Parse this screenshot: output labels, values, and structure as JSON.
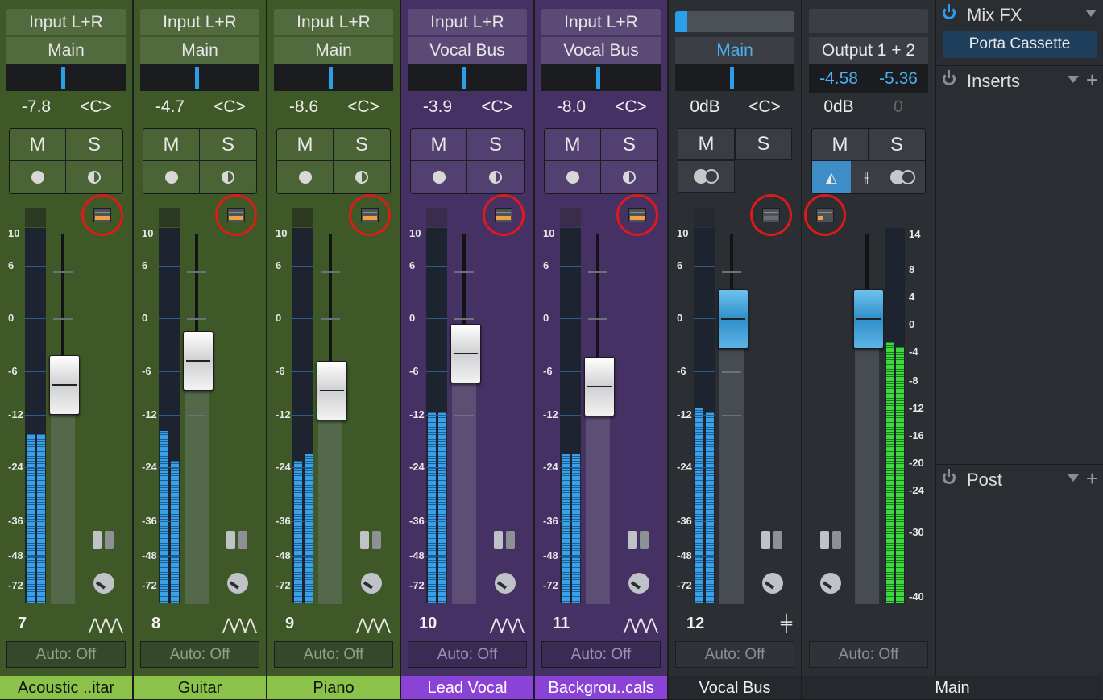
{
  "channels": [
    {
      "input": "Input L+R",
      "output": "Main",
      "vol": "-7.8",
      "pan": "<C>",
      "mute": "M",
      "solo": "S",
      "number": "7",
      "name": "Acoustic ..itar",
      "auto": "Auto: Off",
      "color": "green",
      "fader_db": -7.8
    },
    {
      "input": "Input L+R",
      "output": "Main",
      "vol": "-4.7",
      "pan": "<C>",
      "mute": "M",
      "solo": "S",
      "number": "8",
      "name": "Guitar",
      "auto": "Auto: Off",
      "color": "green",
      "fader_db": -4.7
    },
    {
      "input": "Input L+R",
      "output": "Main",
      "vol": "-8.6",
      "pan": "<C>",
      "mute": "M",
      "solo": "S",
      "number": "9",
      "name": "Piano",
      "auto": "Auto: Off",
      "color": "green",
      "fader_db": -8.6
    },
    {
      "input": "Input L+R",
      "output": "Vocal Bus",
      "vol": "-3.9",
      "pan": "<C>",
      "mute": "M",
      "solo": "S",
      "number": "10",
      "name": "Lead Vocal",
      "auto": "Auto: Off",
      "color": "purple",
      "fader_db": -3.9
    },
    {
      "input": "Input L+R",
      "output": "Vocal Bus",
      "vol": "-8.0",
      "pan": "<C>",
      "mute": "M",
      "solo": "S",
      "number": "11",
      "name": "Backgrou..cals",
      "auto": "Auto: Off",
      "color": "purple",
      "fader_db": -8.0
    },
    {
      "input": "",
      "output": "Main",
      "vol": "0dB",
      "pan": "<C>",
      "mute": "M",
      "solo": "S",
      "number": "12",
      "name": "Vocal Bus",
      "auto": "Auto: Off",
      "color": "dark",
      "fader_db": 0
    }
  ],
  "main": {
    "output": "Output 1 + 2",
    "peak_l": "-4.58",
    "peak_r": "-5.36",
    "vol": "0dB",
    "pan": "0",
    "mute": "M",
    "solo": "S",
    "name": "Main",
    "auto": "Auto: Off"
  },
  "scale": [
    "10",
    "6",
    "0",
    "-6",
    "-12",
    "-24",
    "-36",
    "-48",
    "-72"
  ],
  "main_scale": [
    "14",
    "8",
    "4",
    "0",
    "-4",
    "-8",
    "-12",
    "-16",
    "-20",
    "-24",
    "-30",
    "-40"
  ],
  "right_panel": {
    "mixfx": "Mix FX",
    "mixfx_slot": "Porta Cassette",
    "inserts": "Inserts",
    "post": "Post",
    "plus": "+"
  },
  "colors": {
    "green": "#3e5827",
    "purple": "#453163",
    "accent": "#2a9fe8",
    "highlight": "#e01919",
    "meter": "#3aa0e8"
  }
}
